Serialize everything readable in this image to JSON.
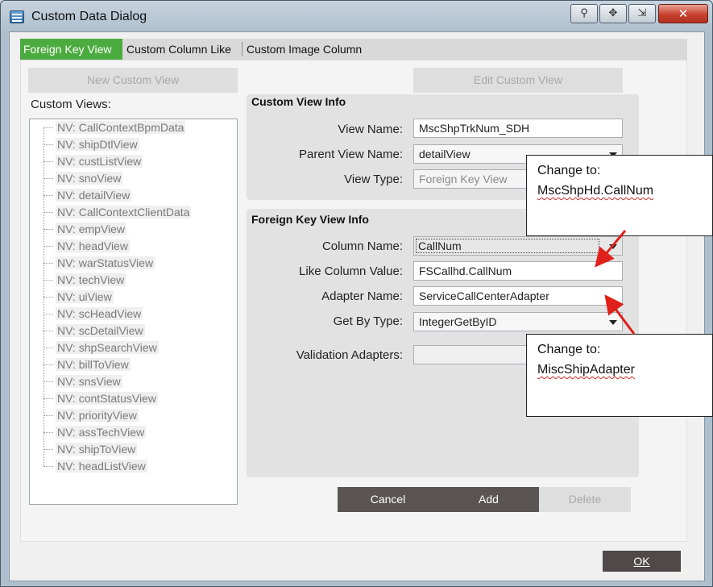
{
  "window": {
    "title": "Custom Data Dialog"
  },
  "tabs": [
    {
      "label": "Foreign Key View"
    },
    {
      "label": "Custom Column Like"
    },
    {
      "label": "Custom Image Column"
    }
  ],
  "buttons": {
    "new_custom_view": "New Custom View",
    "edit_custom_view": "Edit Custom View",
    "cancel": "Cancel",
    "add": "Add",
    "delete": "Delete",
    "ok": "OK"
  },
  "custom_views": {
    "label": "Custom Views:",
    "items": [
      "NV: CallContextBpmData",
      "NV: shipDtlView",
      "NV: custListView",
      "NV: snoView",
      "NV: detailView",
      "NV: CallContextClientData",
      "NV: empView",
      "NV: headView",
      "NV: warStatusView",
      "NV: techView",
      "NV: uiView",
      "NV: scHeadView",
      "NV: scDetailView",
      "NV: shpSearchView",
      "NV: billToView",
      "NV: snsView",
      "NV: contStatusView",
      "NV: priorityView",
      "NV: assTechView",
      "NV: shipToView",
      "NV: headListView"
    ]
  },
  "custom_view_info": {
    "title": "Custom View Info",
    "view_name_label": "View Name:",
    "view_name_value": "MscShpTrkNum_SDH",
    "parent_view_name_label": "Parent View Name:",
    "parent_view_name_value": "detailView",
    "view_type_label": "View Type:",
    "view_type_value": "Foreign Key View"
  },
  "foreign_key_view_info": {
    "title": "Foreign Key View Info",
    "column_name_label": "Column Name:",
    "column_name_value": "CallNum",
    "like_column_value_label": "Like Column Value:",
    "like_column_value_value": "FSCallhd.CallNum",
    "adapter_name_label": "Adapter Name:",
    "adapter_name_value": "ServiceCallCenterAdapter",
    "get_by_type_label": "Get By Type:",
    "get_by_type_value": "IntegerGetByID",
    "validation_adapters_label": "Validation Adapters:",
    "validation_adapters_value": ""
  },
  "callouts": [
    {
      "line1": "Change to:",
      "line2": "MscShpHd.CallNum"
    },
    {
      "line1": "Change to:",
      "line2": "MiscShipAdapter"
    }
  ],
  "colors": {
    "active_tab": "#4cab3f",
    "dark_button": "#5a5454",
    "annotation_arrow": "#e0201a"
  },
  "icons": {
    "app": "window-app-icon",
    "titlebar": [
      "pin-icon",
      "move-icon",
      "restore-icon",
      "close-icon"
    ]
  }
}
